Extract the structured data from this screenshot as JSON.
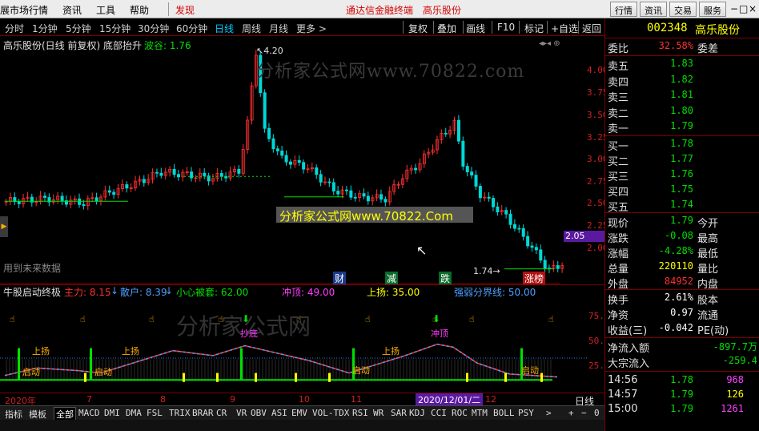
{
  "menubar": {
    "items": [
      "展市场行情",
      "资讯",
      "工具",
      "帮助",
      "发现"
    ],
    "center_title": "通达信金融终端",
    "stock_title": "高乐股份",
    "right_buttons": [
      "行情",
      "资讯",
      "交易",
      "服务"
    ],
    "window_controls": [
      "−",
      "□",
      "×"
    ]
  },
  "periods": [
    "分时",
    "1分钟",
    "5分钟",
    "15分钟",
    "30分钟",
    "60分钟",
    "日线",
    "周线",
    "月线",
    "更多 >"
  ],
  "active_period": "日线",
  "toolbar": [
    "复权",
    "叠加",
    "画线",
    "F10",
    "标记",
    "+自选",
    "返回"
  ],
  "chart": {
    "header_title": "高乐股份(日线 前复权) 底部抬升",
    "header_valley": "波谷: 1.76",
    "peak_label": "4.20",
    "low_label": "1.74",
    "price_ticks": [
      "4.00",
      "3.75",
      "3.50",
      "3.25",
      "3.00",
      "2.75",
      "2.50",
      "2.25",
      "2.00"
    ],
    "current_price_tag": "2.05",
    "future_data_note": "用到未来数据",
    "watermark": "分析家公式网www.70822.com",
    "center_banner": "分析家公式网www.70822.Com",
    "markers": [
      "财",
      "减",
      "跌",
      "涨榜"
    ]
  },
  "indicator": {
    "name": "牛股启动终极",
    "main_label": "主力: 8.15",
    "retail_label": "散户: 8.39",
    "caution_label": "小心被套: 62.00",
    "top_label": "冲顶: 49.00",
    "rise_label": "上扬: 35.00",
    "divide_label": "强弱分界线: 50.00",
    "ticks": [
      "75.00",
      "50.00",
      "25.00"
    ],
    "annotations": [
      "上扬",
      "启动",
      "上扬",
      "启动",
      "抄底",
      "上扬",
      "启动",
      "冲顶",
      "启动"
    ],
    "watermark": "分析家公式网"
  },
  "dates": [
    "2020年",
    "7",
    "8",
    "9",
    "10",
    "11",
    "12"
  ],
  "date_tag": "2020/12/01/二",
  "period_footer": "日线",
  "tabs": [
    "指标",
    "模板",
    "全部",
    "MACD",
    "DMI",
    "DMA",
    "FSL",
    "TRIX",
    "BRAR",
    "CR",
    "VR",
    "OBV",
    "ASI",
    "EMV",
    "VOL-TDX",
    "RSI",
    "WR",
    "SAR",
    "KDJ",
    "CCI",
    "ROC",
    "MTM",
    "BOLL",
    "PSY"
  ],
  "active_tab": "全部",
  "tab_controls": [
    ">",
    "+",
    "−",
    "0"
  ],
  "quote": {
    "code": "002348",
    "name": "高乐股份",
    "weibi_label": "委比",
    "weibi_value": "32.58%",
    "weicha_label": "委差",
    "asks": [
      {
        "label": "卖五",
        "price": "1.83"
      },
      {
        "label": "卖四",
        "price": "1.82"
      },
      {
        "label": "卖三",
        "price": "1.81"
      },
      {
        "label": "卖二",
        "price": "1.80"
      },
      {
        "label": "卖一",
        "price": "1.79"
      }
    ],
    "bids": [
      {
        "label": "买一",
        "price": "1.78"
      },
      {
        "label": "买二",
        "price": "1.77"
      },
      {
        "label": "买三",
        "price": "1.76"
      },
      {
        "label": "买四",
        "price": "1.75"
      },
      {
        "label": "买五",
        "price": "1.74"
      }
    ],
    "stats": [
      {
        "l1": "现价",
        "v1": "1.79",
        "l2": "今开"
      },
      {
        "l1": "涨跌",
        "v1": "-0.08",
        "l2": "最高"
      },
      {
        "l1": "涨幅",
        "v1": "-4.28%",
        "l2": "最低"
      },
      {
        "l1": "总量",
        "v1": "220110",
        "l2": "量比"
      },
      {
        "l1": "外盘",
        "v1": "84952",
        "l2": "内盘"
      }
    ],
    "finance": [
      {
        "l1": "换手",
        "v1": "2.61%",
        "l2": "股本"
      },
      {
        "l1": "净资",
        "v1": "0.97",
        "l2": "流通"
      },
      {
        "l1": "收益(三)",
        "v1": "-0.042",
        "l2": "PE(动)"
      }
    ],
    "flows": [
      {
        "label": "净流入额",
        "value": "-897.7万"
      },
      {
        "label": "大宗流入",
        "value": "-259.4"
      }
    ],
    "ticks": [
      {
        "time": "14:56",
        "price": "1.78",
        "vol": "968"
      },
      {
        "time": "14:57",
        "price": "1.79",
        "vol": "126"
      },
      {
        "time": "15:00",
        "price": "1.79",
        "vol": "1261"
      }
    ]
  }
}
